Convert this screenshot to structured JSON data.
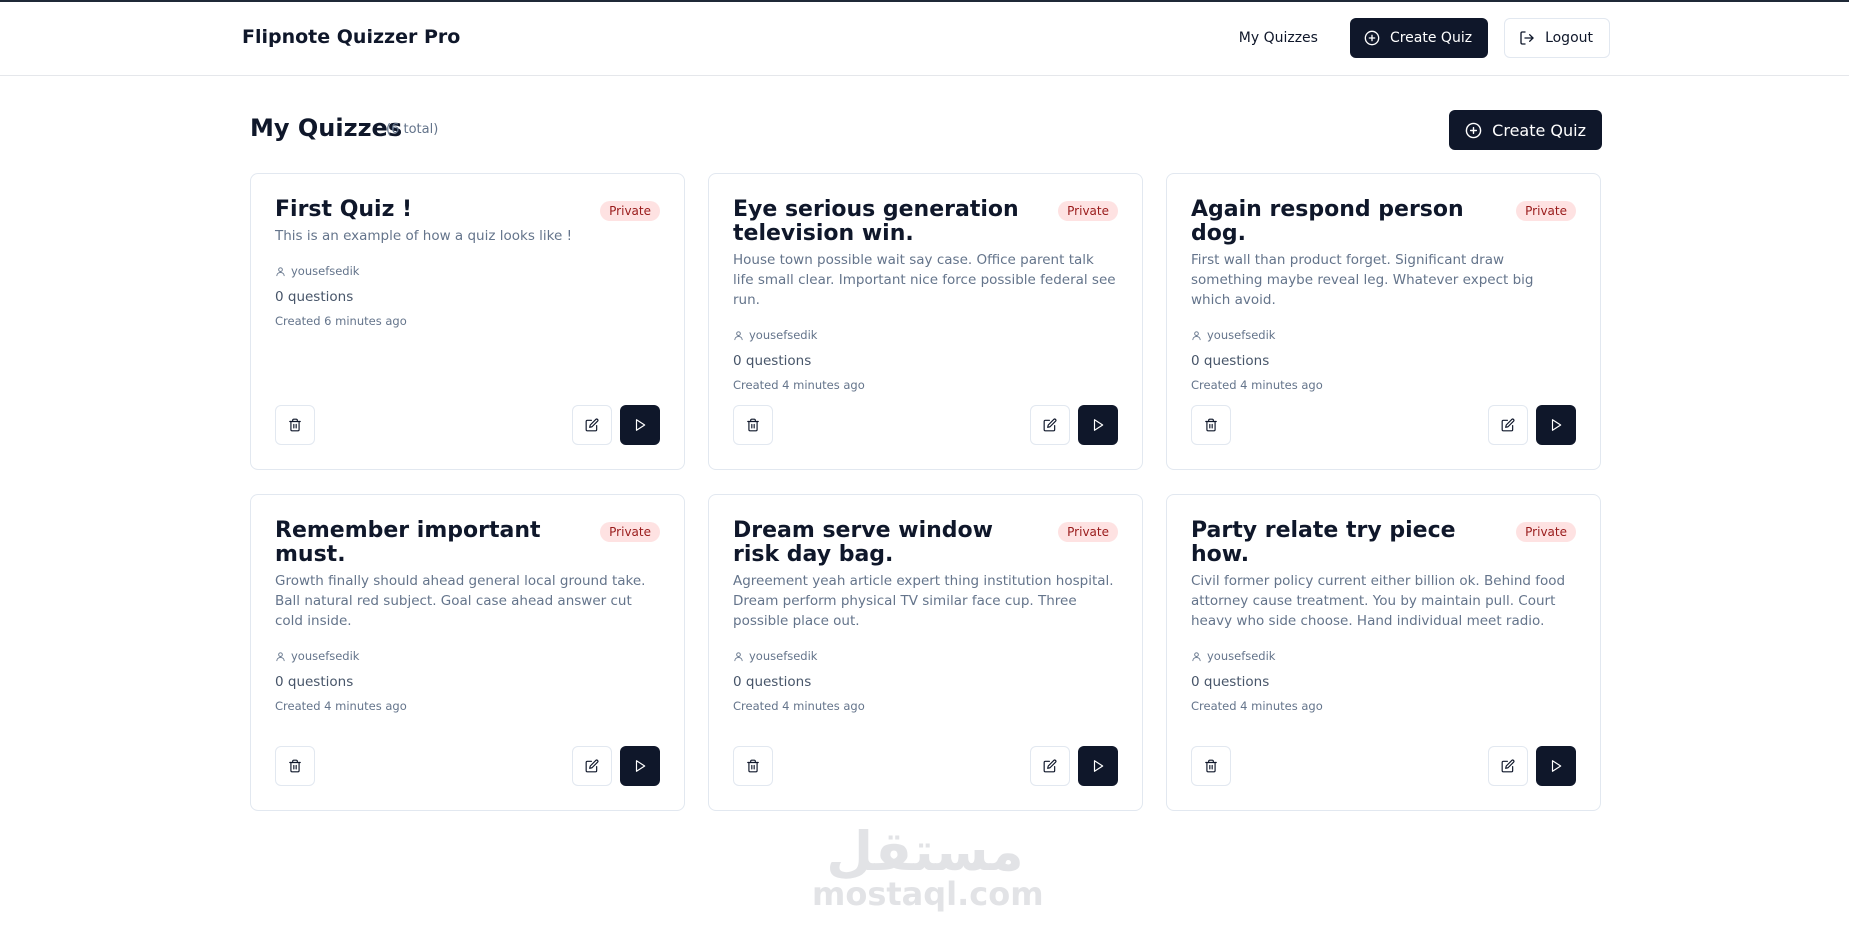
{
  "header": {
    "brand": "Flipnote Quizzer Pro",
    "nav_my_quizzes": "My Quizzes",
    "create_quiz": "Create Quiz",
    "logout": "Logout"
  },
  "page": {
    "title": "My Quizzes",
    "count": "(6 total)",
    "create_quiz": "Create Quiz"
  },
  "quizzes": [
    {
      "title": "First Quiz !",
      "badge": "Private",
      "description": "This is an example of how a quiz looks like !",
      "author": "yousefsedik",
      "questions": "0 questions",
      "created": "Created 6 minutes ago"
    },
    {
      "title": "Eye serious generation television win.",
      "badge": "Private",
      "description": "House town possible wait say case. Office parent talk life small clear. Important nice force possible federal see run.",
      "author": "yousefsedik",
      "questions": "0 questions",
      "created": "Created 4 minutes ago"
    },
    {
      "title": "Again respond person dog.",
      "badge": "Private",
      "description": "First wall than product forget. Significant draw something maybe reveal leg. Whatever expect big which avoid.",
      "author": "yousefsedik",
      "questions": "0 questions",
      "created": "Created 4 minutes ago"
    },
    {
      "title": "Remember important must.",
      "badge": "Private",
      "description": "Growth finally should ahead general local ground take. Ball natural red subject. Goal case ahead answer cut cold inside.",
      "author": "yousefsedik",
      "questions": "0 questions",
      "created": "Created 4 minutes ago"
    },
    {
      "title": "Dream serve window risk day bag.",
      "badge": "Private",
      "description": "Agreement yeah article expert thing institution hospital. Dream perform physical TV similar face cup. Three possible place out.",
      "author": "yousefsedik",
      "questions": "0 questions",
      "created": "Created 4 minutes ago"
    },
    {
      "title": "Party relate try piece how.",
      "badge": "Private",
      "description": "Civil former policy current either billion ok. Behind food attorney cause treatment. You by maintain pull. Court heavy who side choose. Hand individual meet radio.",
      "author": "yousefsedik",
      "questions": "0 questions",
      "created": "Created 4 minutes ago"
    }
  ],
  "watermark": {
    "arabic": "مستقل",
    "latin": "mostaql.com"
  },
  "icons": {
    "create": "plus-circle-icon",
    "logout": "logout-icon",
    "author": "user-icon",
    "delete": "trash-icon",
    "edit": "edit-icon",
    "play": "play-icon"
  },
  "colors": {
    "primary": "#0f172a",
    "badge_bg": "#fee2e2",
    "badge_text": "#991b1b",
    "muted": "#64748b",
    "border": "#e2e8f0"
  }
}
